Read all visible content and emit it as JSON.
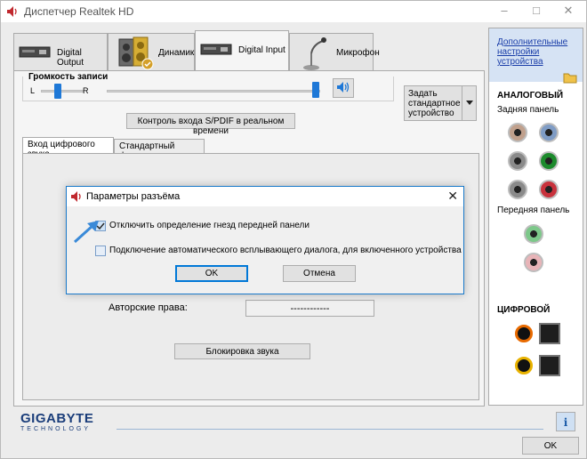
{
  "window": {
    "title": "Диспетчер Realtek HD"
  },
  "devices": {
    "tabs": [
      {
        "label": "Digital Output"
      },
      {
        "label": "Динамики"
      },
      {
        "label": "Digital Input",
        "active": true
      },
      {
        "label": "Микрофон"
      }
    ]
  },
  "recording": {
    "label": "Громкость записи",
    "left": "L",
    "right": "R",
    "balance_level": 0.5,
    "volume_level": 1.0,
    "set_default_button": "Задать стандартное устройство",
    "spdif_button": "Контроль входа S/PDIF в реальном времени"
  },
  "inner_tabs": [
    "Вход цифрового звука",
    "Стандартный формат"
  ],
  "copyright": {
    "label": "Авторские права:",
    "value": "------------"
  },
  "lock_button": "Блокировка звука",
  "dialog": {
    "title": "Параметры разъёма",
    "options": [
      {
        "label": "Отключить определение гнезд передней панели",
        "checked": true
      },
      {
        "label": "Подключение автоматического всплывающего диалога, для включенного устройства",
        "checked": false
      }
    ],
    "ok": "OK",
    "cancel": "Отмена"
  },
  "side": {
    "link": "Дополнительные настройки устройства",
    "analog": "АНАЛОГОВЫЙ",
    "rear": "Задняя панель",
    "front": "Передняя панель",
    "digital": "ЦИФРОВОЙ",
    "rear_jack_colors": [
      "#c0a08c",
      "#7f9cc5",
      "#8a8a8a",
      "#1c8a2c",
      "#8a8a8a",
      "#c8323c"
    ],
    "front_jack_colors": [
      "#7dc88a",
      "#e8b4b8"
    ]
  },
  "footer": {
    "brand": "GIGABYTE",
    "tagline": "TECHNOLOGY",
    "ok": "OK"
  },
  "colors": {
    "accent": "#0078d7",
    "side_link_bg": "#d6e3f4"
  }
}
